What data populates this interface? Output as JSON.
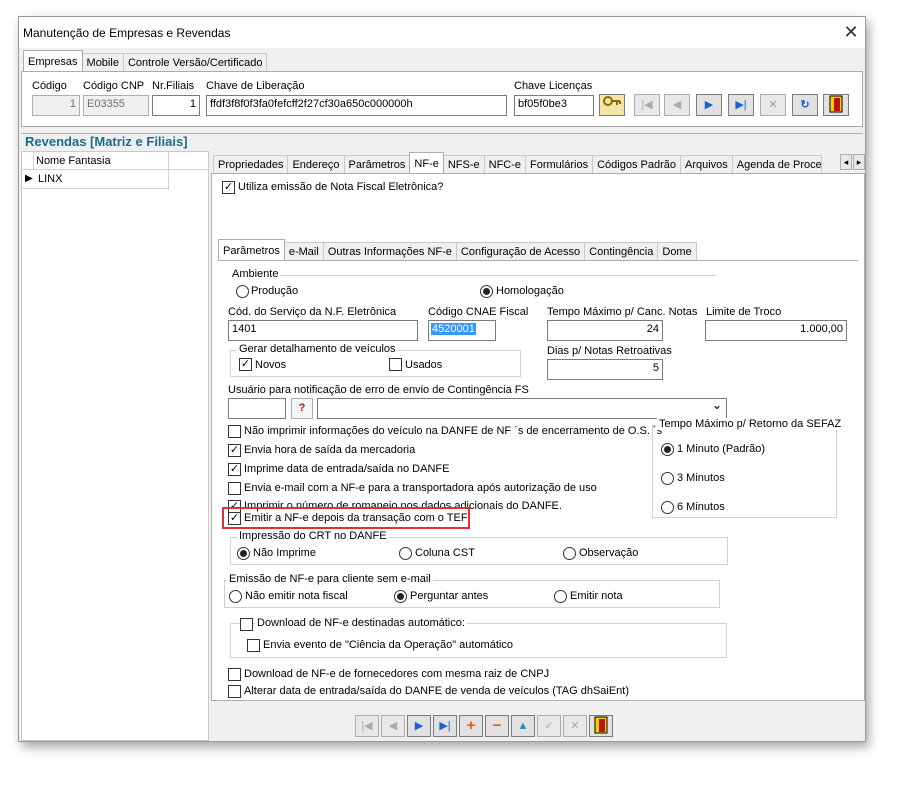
{
  "window": {
    "title": "Manutenção de Empresas e Revendas",
    "close_glyph": "✕"
  },
  "top_tabs": [
    "Empresas",
    "Mobile",
    "Controle Versão/Certificado"
  ],
  "header": {
    "codigo_label": "Código",
    "codigo_value": "1",
    "codigo_cnp_label": "Código CNP",
    "codigo_cnp_value": "E03355",
    "nr_filiais_label": "Nr.Filiais",
    "nr_filiais_value": "1",
    "chave_lib_label": "Chave de Liberação",
    "chave_lib_value": "ffdf3f8f0f3fa0fefcff2f27cf30a650c000000h",
    "chave_lic_label": "Chave Licenças",
    "chave_lic_value": "bf05f0be3"
  },
  "nav_icons": [
    "key-icon",
    "first-icon",
    "prev-icon",
    "next-icon",
    "last-icon",
    "delete-icon",
    "refresh-icon",
    "exit-icon"
  ],
  "revendas": {
    "title": "Revendas [Matriz e Filiais]",
    "column": "Nome Fantasia",
    "rows": [
      "LINX"
    ],
    "row_marker": "▶"
  },
  "main_tabs": [
    "Propriedades",
    "Endereço",
    "Parâmetros",
    "NF-e",
    "NFS-e",
    "NFC-e",
    "Formulários",
    "Códigos Padrão",
    "Arquivos",
    "Agenda de Proces"
  ],
  "scroll_left": "◂",
  "scroll_right": "▸",
  "utiliza_nfe": "Utiliza emissão de Nota Fiscal Eletrônica?",
  "sub_tabs": [
    "Parâmetros",
    "e-Mail",
    "Outras Informações NF-e",
    "Configuração de Acesso",
    "Contingência",
    "Dome"
  ],
  "ambiente": {
    "title": "Ambiente",
    "producao": "Produção",
    "homologacao": "Homologação"
  },
  "fields": {
    "cod_servico_label": "Cód. do Serviço da N.F. Eletrônica",
    "cod_servico_value": "1401",
    "cnae_label": "Código CNAE Fiscal",
    "cnae_value": "4520001",
    "tempo_canc_label": "Tempo Máximo p/ Canc. Notas",
    "tempo_canc_value": "24",
    "limite_troco_label": "Limite de Troco",
    "limite_troco_value": "1.000,00",
    "dias_label": "Dias p/ Notas Retroativas",
    "dias_value": "5"
  },
  "detalhamento": {
    "title": "Gerar detalhamento de veículos",
    "novos": "Novos",
    "usados": "Usados"
  },
  "usuario_label": "Usuário para notificação de erro de envio de Contingência FS",
  "lookup_glyph": "?",
  "dropdown_glyph": "⌄",
  "options": [
    "Não imprimir informações do veículo na DANFE de NF ´s de encerramento de O.S. ´s",
    "Envia hora de saída da mercadoria",
    "Imprime data de entrada/saída no DANFE",
    "Envia e-mail com a NF-e para a transportadora após autorização de uso",
    "Imprimir o número de romaneio nos dados adicionais do DANFE.",
    "Emitir a NF-e depois da transação com o TEF"
  ],
  "check_mark": "✓",
  "sefaz": {
    "title": "Tempo Máximo p/ Retorno da SEFAZ",
    "opt1": "1 Minuto (Padrão)",
    "opt2": "3 Minutos",
    "opt3": "6 Minutos"
  },
  "crt": {
    "title": "Impressão do CRT no DANFE",
    "opt1": "Não Imprime",
    "opt2": "Coluna CST",
    "opt3": "Observação"
  },
  "sem_email": {
    "title": "Emissão de NF-e para cliente sem e-mail",
    "opt1": "Não emitir nota fiscal",
    "opt2": "Perguntar antes",
    "opt3": "Emitir nota"
  },
  "download": {
    "title": "Download de NF-e destinadas automático:",
    "evento": "Envia evento de \"Ciência da Operação\" automático"
  },
  "bottom_options": [
    "Download de NF-e de fornecedores com mesma raiz de CNPJ",
    "Alterar data de entrada/saída do DANFE de venda de veículos (TAG dhSaiEnt)"
  ],
  "colors": {
    "highlight": "#e03030",
    "section_title": "#1e6b86",
    "selection": "#3399ff"
  }
}
